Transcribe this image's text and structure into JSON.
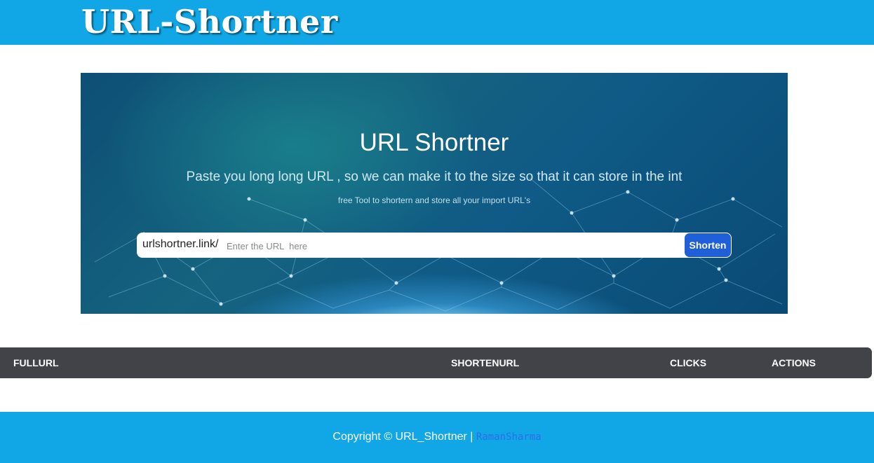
{
  "header": {
    "brand": "URL-Shortner"
  },
  "hero": {
    "title": "URL Shortner",
    "subtitle": "Paste you long long URL , so we can make it to the size so that it can store in the int",
    "tagline": "free Tool to shortern and store all your import URL's",
    "prefix": "urlshortner.link/",
    "input_value": "",
    "input_placeholder": "Enter the URL  here",
    "button_label": "Shorten"
  },
  "table": {
    "columns": [
      "FULLURL",
      "SHORTENURL",
      "CLICKS",
      "ACTIONS"
    ],
    "rows": []
  },
  "footer": {
    "copyright": "Copyright © URL_Shortner | ",
    "author_link": "RamanSharma"
  },
  "colors": {
    "accent": "#11a7e6",
    "button": "#1f5fd8",
    "table_header": "#414348"
  }
}
